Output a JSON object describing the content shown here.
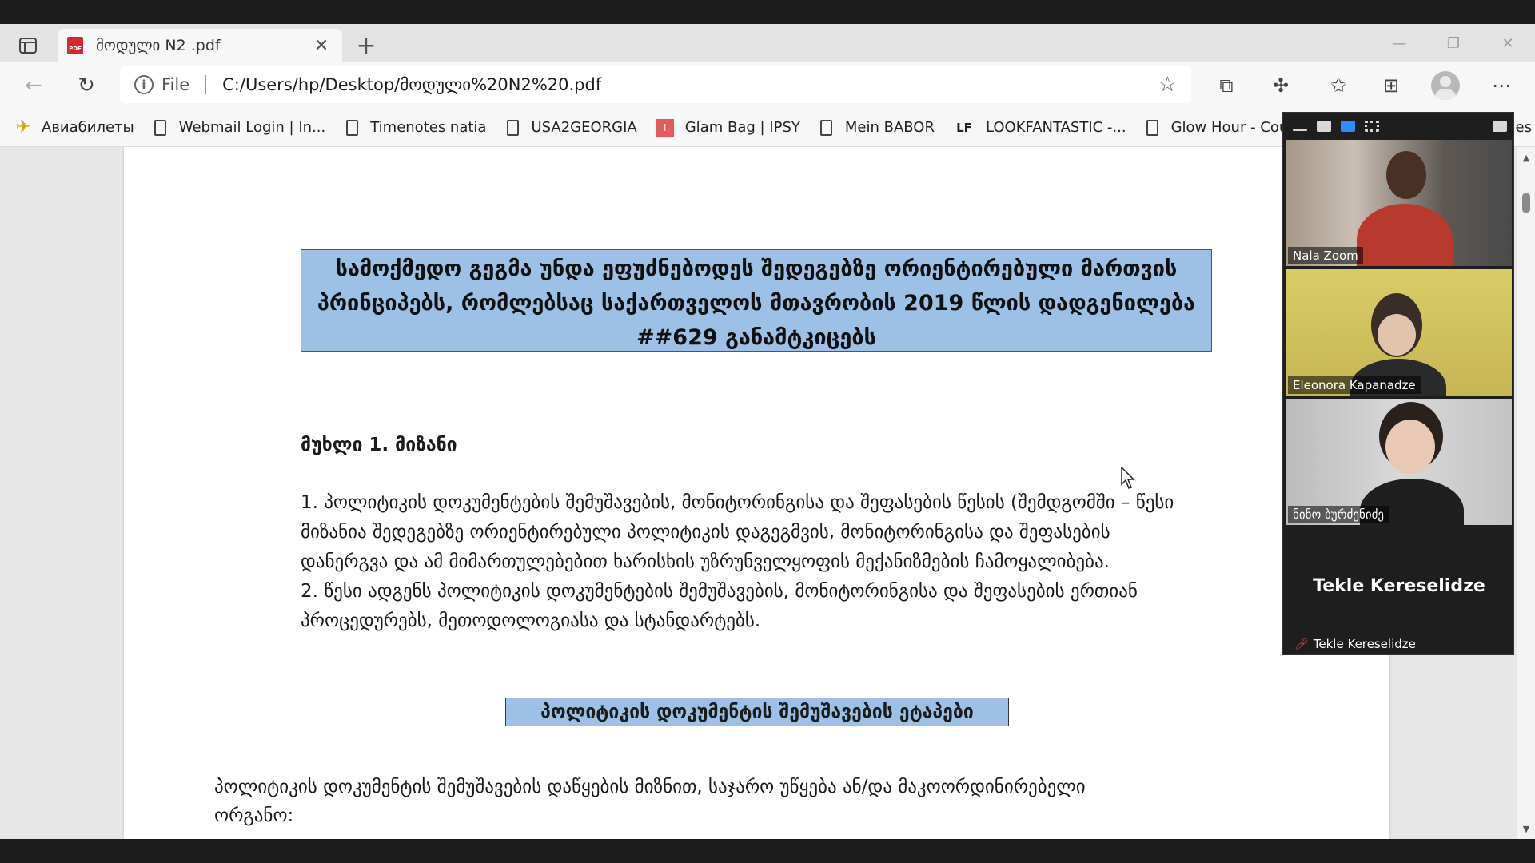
{
  "tab": {
    "title": "მოდული N2 .pdf",
    "icon": "pdf-icon"
  },
  "address": {
    "scheme": "File",
    "url": "C:/Users/hp/Desktop/მოდული%20N2%20.pdf"
  },
  "bookmarks": [
    {
      "label": "Авиабилеты",
      "icon": "plane-icon"
    },
    {
      "label": "Webmail Login | In...",
      "icon": "page-icon"
    },
    {
      "label": "Timenotes natia",
      "icon": "page-icon"
    },
    {
      "label": "USA2GEORGIA",
      "icon": "page-icon"
    },
    {
      "label": "Glam Bag | IPSY",
      "icon": "ipsy-icon"
    },
    {
      "label": "Mein BABOR",
      "icon": "page-icon"
    },
    {
      "label": "LOOKFANTASTIC -...",
      "icon": "lf-icon"
    },
    {
      "label": "Glow Hour - Courtn...",
      "icon": "page-icon"
    }
  ],
  "bookmark_icon_lf": "LF",
  "bookmark_icon_ipsy": "I",
  "bookmark_overflow": "es",
  "pdf": {
    "title_lines": [
      "სამოქმედო გეგმა უნდა ეფუძნებოდეს შედეგებზე ორიენტირებული მართვის",
      "პრინციპებს, რომლებსაც საქართველოს მთავრობის 2019 წლის დადგენილება",
      "##629 განამტკიცებს"
    ],
    "article_heading": "მუხლი 1. მიზანი",
    "paragraph_lines": [
      "1. პოლიტიკის დოკუმენტების შემუშავების, მონიტორინგისა და შეფასების წესის (შემდგომში – წესი",
      "მიზანია შედეგებზე ორიენტირებული პოლიტიკის დაგეგმვის, მონიტორინგისა და შეფასების",
      "დანერგვა და ამ მიმართულებებით ხარისხის უზრუნველყოფის მექანიზმების ჩამოყალიბება.",
      "2. წესი ადგენს პოლიტიკის დოკუმენტების შემუშავების, მონიტორინგისა და შეფასების ერთიან",
      "პროცედურებს, მეთოდოლოგიასა და სტანდარტებს."
    ],
    "section_heading": "პოლიტიკის დოკუმენტის შემუშავების ეტაპები",
    "bottom_lines": [
      "პოლიტიკის დოკუმენტის შემუშავების დაწყების მიზნით, საჯარო უწყება ან/და მაკოორდინირებელი",
      "ორგანო:"
    ]
  },
  "zoom": {
    "participants": [
      {
        "name": "Nala Zoom"
      },
      {
        "name": "Eleonora Kapanadze"
      },
      {
        "name": "ნინო ბურძენიძე"
      },
      {
        "name": "Tekle Kereselidze",
        "display_name": "Tekle Kereselidze",
        "muted": true
      }
    ]
  },
  "colors": {
    "highlight": "#9cc0e6",
    "zoom_accent": "#2d8cff",
    "muted": "#e24848"
  }
}
